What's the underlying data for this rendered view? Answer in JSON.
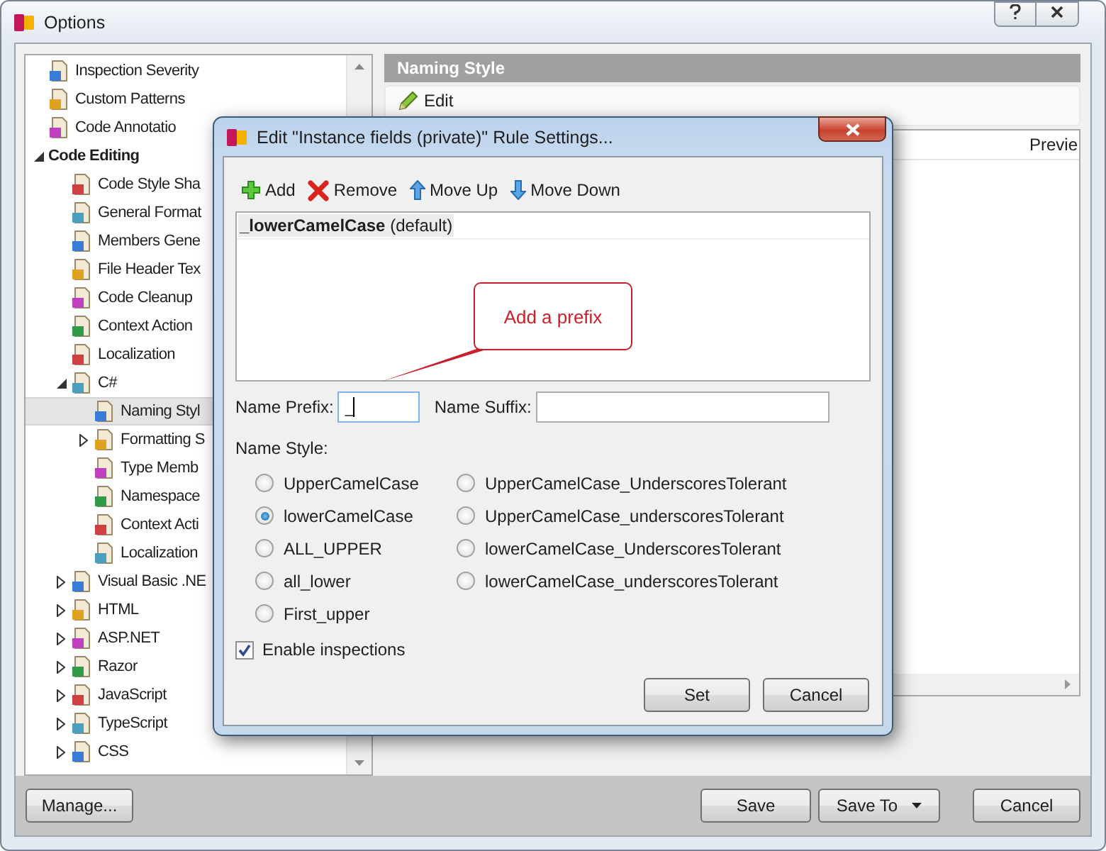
{
  "window": {
    "title": "Options"
  },
  "tree": [
    {
      "children": [
        {
          "label": "Inspection Severity",
          "kind": "page",
          "selected": false
        },
        {
          "label": "Custom Patterns",
          "kind": "page",
          "selected": false
        },
        {
          "label": "Code Annotatio",
          "kind": "page",
          "selected": false
        }
      ]
    },
    {
      "label": "Code Editing",
      "kind": "category",
      "expanded": true,
      "selected": false,
      "children": [
        {
          "label": "Code Style Sha",
          "kind": "page",
          "selected": false
        },
        {
          "label": "General Format",
          "kind": "page",
          "selected": false
        },
        {
          "label": "Members Gene",
          "kind": "page",
          "selected": false
        },
        {
          "label": "File Header Tex",
          "kind": "page",
          "selected": false
        },
        {
          "label": "Code Cleanup",
          "kind": "page",
          "selected": false
        },
        {
          "label": "Context Action",
          "kind": "page",
          "selected": false
        },
        {
          "label": "Localization",
          "kind": "page",
          "selected": false
        },
        {
          "label": "C#",
          "kind": "page",
          "expanded": true,
          "selected": false,
          "children": [
            {
              "label": "Naming Styl",
              "kind": "page",
              "selected": true
            },
            {
              "label": "Formatting S",
              "kind": "page",
              "expanded": false,
              "selected": false
            },
            {
              "label": "Type Memb",
              "kind": "page",
              "selected": false
            },
            {
              "label": "Namespace",
              "kind": "page",
              "selected": false
            },
            {
              "label": "Context Acti",
              "kind": "page",
              "selected": false
            },
            {
              "label": "Localization",
              "kind": "page",
              "selected": false
            }
          ]
        },
        {
          "label": "Visual Basic .NE",
          "kind": "page",
          "expanded": false,
          "selected": false
        },
        {
          "label": "HTML",
          "kind": "page",
          "expanded": false,
          "selected": false
        },
        {
          "label": "ASP.NET",
          "kind": "page",
          "expanded": false,
          "selected": false
        },
        {
          "label": "Razor",
          "kind": "page",
          "expanded": false,
          "selected": false
        },
        {
          "label": "JavaScript",
          "kind": "page",
          "expanded": false,
          "selected": false
        },
        {
          "label": "TypeScript",
          "kind": "page",
          "expanded": false,
          "selected": false
        },
        {
          "label": "CSS",
          "kind": "page",
          "expanded": false,
          "selected": false
        }
      ]
    }
  ],
  "panel": {
    "title": "Naming Style",
    "toolbar": [
      "Edit"
    ],
    "column_header": "Previe"
  },
  "footer": {
    "buttons": [
      {
        "label": "Manage...",
        "kind": "plain"
      },
      {
        "label": "Save",
        "kind": "plain"
      },
      {
        "label": "Save To",
        "kind": "split"
      },
      {
        "label": "Cancel",
        "kind": "plain"
      }
    ]
  },
  "dialog": {
    "title": "Edit \"Instance fields (private)\" Rule Settings...",
    "toolbar": [
      {
        "label": "Add",
        "kind": "add"
      },
      {
        "label": "Remove",
        "kind": "remove"
      },
      {
        "label": "Move Up",
        "kind": "up"
      },
      {
        "label": "Move Down",
        "kind": "down"
      }
    ],
    "rules": [
      {
        "name": "_lowerCamelCase",
        "note": "(default)",
        "selected": true
      }
    ],
    "prefix": {
      "label": "Name Prefix:",
      "value": "_"
    },
    "suffix": {
      "label": "Name Suffix:"
    },
    "name_style": {
      "label": "Name Style:",
      "columns": [
        [
          {
            "label": "UpperCamelCase",
            "selected": false
          },
          {
            "label": "lowerCamelCase",
            "selected": true
          },
          {
            "label": "ALL_UPPER",
            "selected": false
          },
          {
            "label": "all_lower",
            "selected": false
          },
          {
            "label": "First_upper",
            "selected": false
          }
        ],
        [
          {
            "label": "UpperCamelCase_UnderscoresTolerant",
            "selected": false
          },
          {
            "label": "UpperCamelCase_underscoresTolerant",
            "selected": false
          },
          {
            "label": "lowerCamelCase_UnderscoresTolerant",
            "selected": false
          },
          {
            "label": "lowerCamelCase_underscoresTolerant",
            "selected": false
          }
        ]
      ]
    },
    "enable_inspections": {
      "label": "Enable inspections",
      "checked": true
    },
    "buttons": [
      "Set",
      "Cancel"
    ]
  },
  "callout": {
    "text": "Add a prefix"
  }
}
